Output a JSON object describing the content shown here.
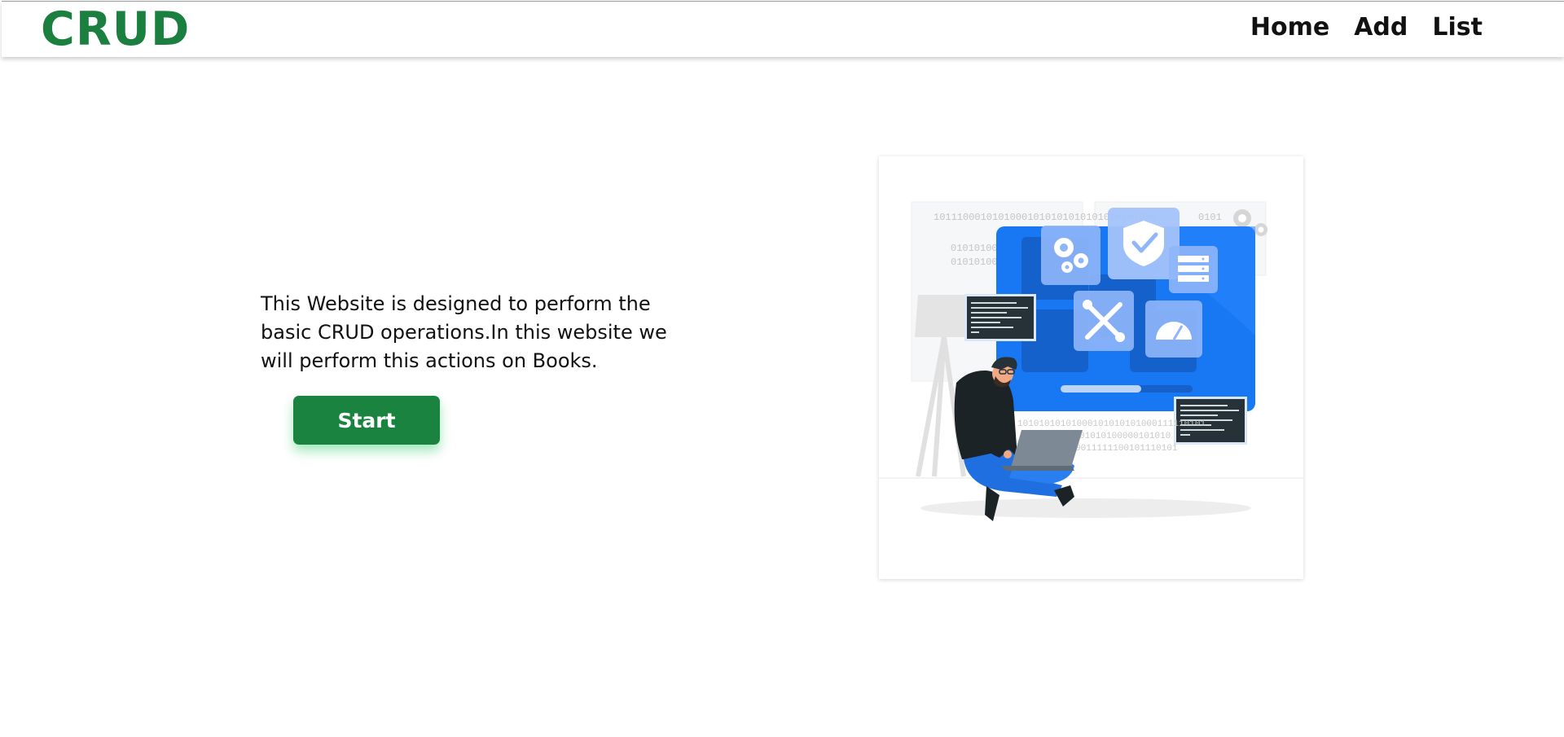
{
  "header": {
    "brand": "CRUD",
    "nav": [
      {
        "label": "Home"
      },
      {
        "label": "Add"
      },
      {
        "label": "List"
      }
    ]
  },
  "main": {
    "description": "This Website is designed to perform the basic CRUD operations.In this website we will perform this actions on Books.",
    "start_label": "Start"
  },
  "illustration": {
    "binary_rows": [
      "10111000101010001010101010101010101000",
      "01010100",
      "01010100",
      "10101010101000101010101000111110101",
      "010101000101010100000101010",
      "01010100000011111100101110101"
    ],
    "binary_tail": "0101",
    "colors": {
      "screen": "#1877f2",
      "tile": "#8fb6f8",
      "terminal": "#263238",
      "shirt": "#1c2326",
      "pants": "#1f6fe0"
    }
  },
  "colors": {
    "brand": "#1a7f3f",
    "button": "#1a8340",
    "button_glow": "#34cd68"
  }
}
